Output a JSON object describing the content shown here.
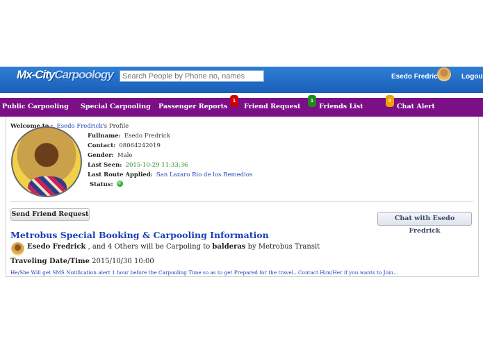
{
  "header": {
    "logo_part1": "Mx-City",
    "logo_part2": "Carpoology",
    "search_placeholder": "Search People by Phone no, names",
    "user_name": "Esedo Fredrick",
    "logout_label": "Logout"
  },
  "nav": {
    "items": [
      {
        "label": "Public Carpooling"
      },
      {
        "label": "Special Carpooling"
      },
      {
        "label": "Passenger Reports"
      },
      {
        "label": "Friend Request",
        "badge": "1",
        "badge_color": "#cc0000"
      },
      {
        "label": "Friends List",
        "badge": "1",
        "badge_color": "#1f8a1f"
      },
      {
        "label": "Chat Alert",
        "badge": "0",
        "badge_color": "#f0a000"
      }
    ]
  },
  "profile": {
    "welcome_label": "Welcome to :",
    "welcome_name": "Esedo Fredrick",
    "welcome_suffix": "'s Profile",
    "fullname_label": "Fullname:",
    "fullname": "Esedo Fredrick",
    "contact_label": "Contact:",
    "contact": "08064242019",
    "gender_label": "Gender:",
    "gender": "Male",
    "last_seen_label": "Last Seen:",
    "last_seen": "2015-10-29 11:33:36",
    "last_route_label": "Last Route Applied:",
    "last_route": "San Lazaro Rio de los Remedios",
    "status_label": "Status:",
    "status_color": "#2aa52a"
  },
  "actions": {
    "send_request": "Send Friend Request",
    "chat_with": "Chat with Esedo Fredrick"
  },
  "booking": {
    "title": "Metrobus Special Booking & Carpooling Information",
    "driver": "Esedo Fredrick",
    "mid_text": ", and 4 Others will be Carpoling to",
    "destination": "balderas",
    "by_text": "by Metrobus Transit",
    "travel_label": "Traveling Date/Time",
    "travel_value": "2015/10/30 10:00",
    "notify": "He/She Will get SMS Notification alert 1 hour before the Carpooling Time so as to get Prepared for the travel...Contact Him/Her if you wants to Join..."
  }
}
